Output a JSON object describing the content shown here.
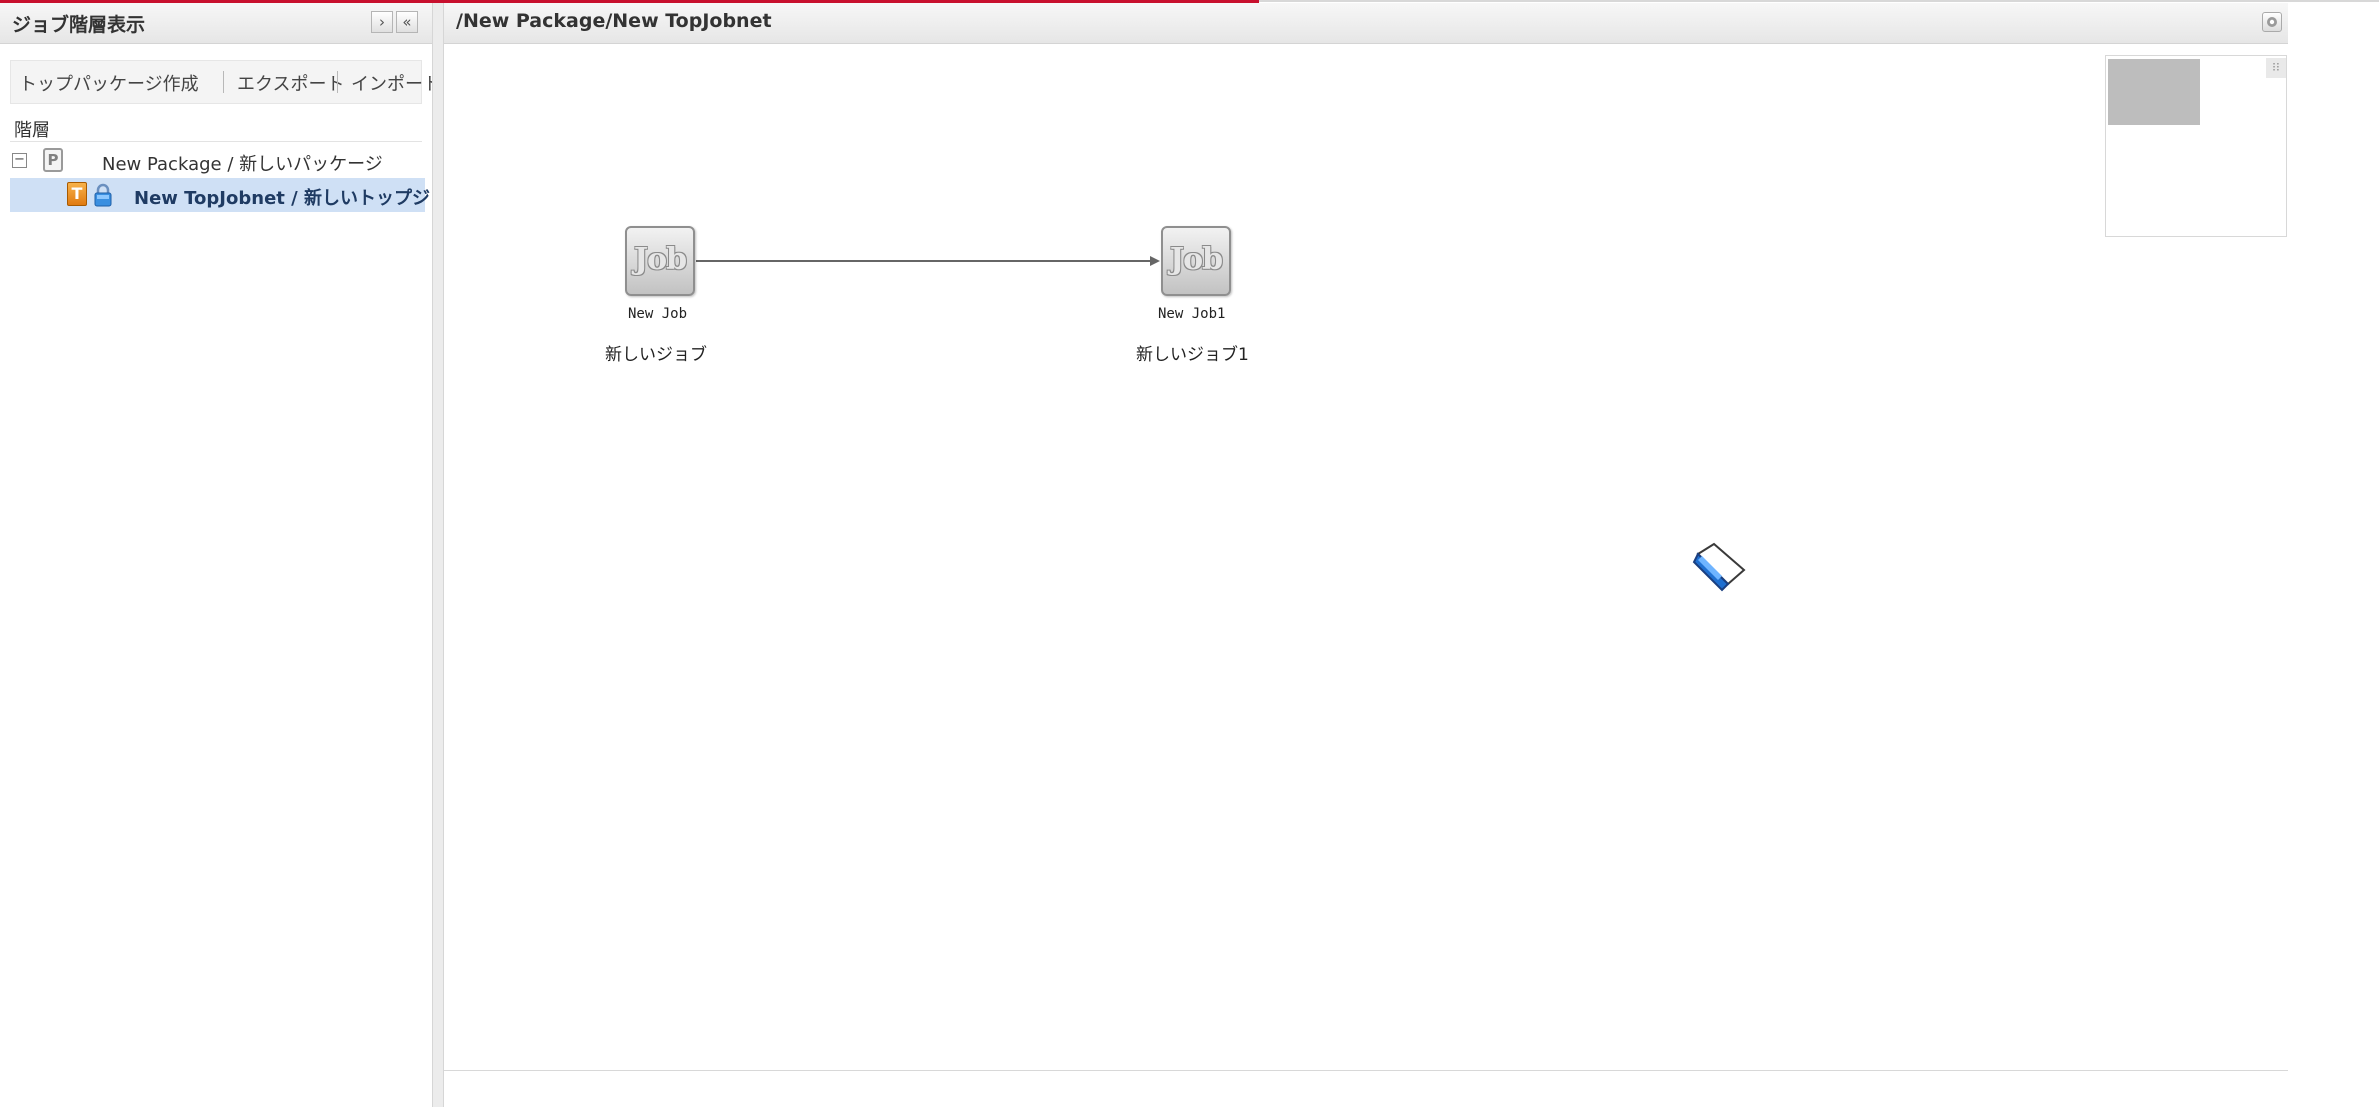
{
  "left_panel": {
    "title": "ジョブ階層表示",
    "btn_expand": "›",
    "btn_collapse": "«",
    "toolbar": {
      "create_top_package": "トップパッケージ作成",
      "export": "エクスポート",
      "import": "インポート"
    },
    "hierarchy_label": "階層",
    "tree": {
      "package": {
        "expander": "−",
        "icon_letter": "P",
        "label": "New Package / 新しいパッケージ"
      },
      "topjobnet": {
        "icon_letter": "T",
        "label": "New TopJobnet / 新しいトップジョ"
      }
    }
  },
  "right_panel": {
    "path": "/New Package/New TopJobnet",
    "settings_icon": "gear-icon"
  },
  "canvas": {
    "jobs": [
      {
        "icon_text": "Job",
        "name": "New Job",
        "japanese_name": "新しいジョブ"
      },
      {
        "icon_text": "Job",
        "name": "New Job1",
        "japanese_name": "新しいジョブ1"
      }
    ],
    "overview_toggle": "⁝⁝"
  },
  "colors": {
    "progress": "#c8102e",
    "selected_row": "#cfe0f5",
    "header_bg": "#ececec"
  }
}
